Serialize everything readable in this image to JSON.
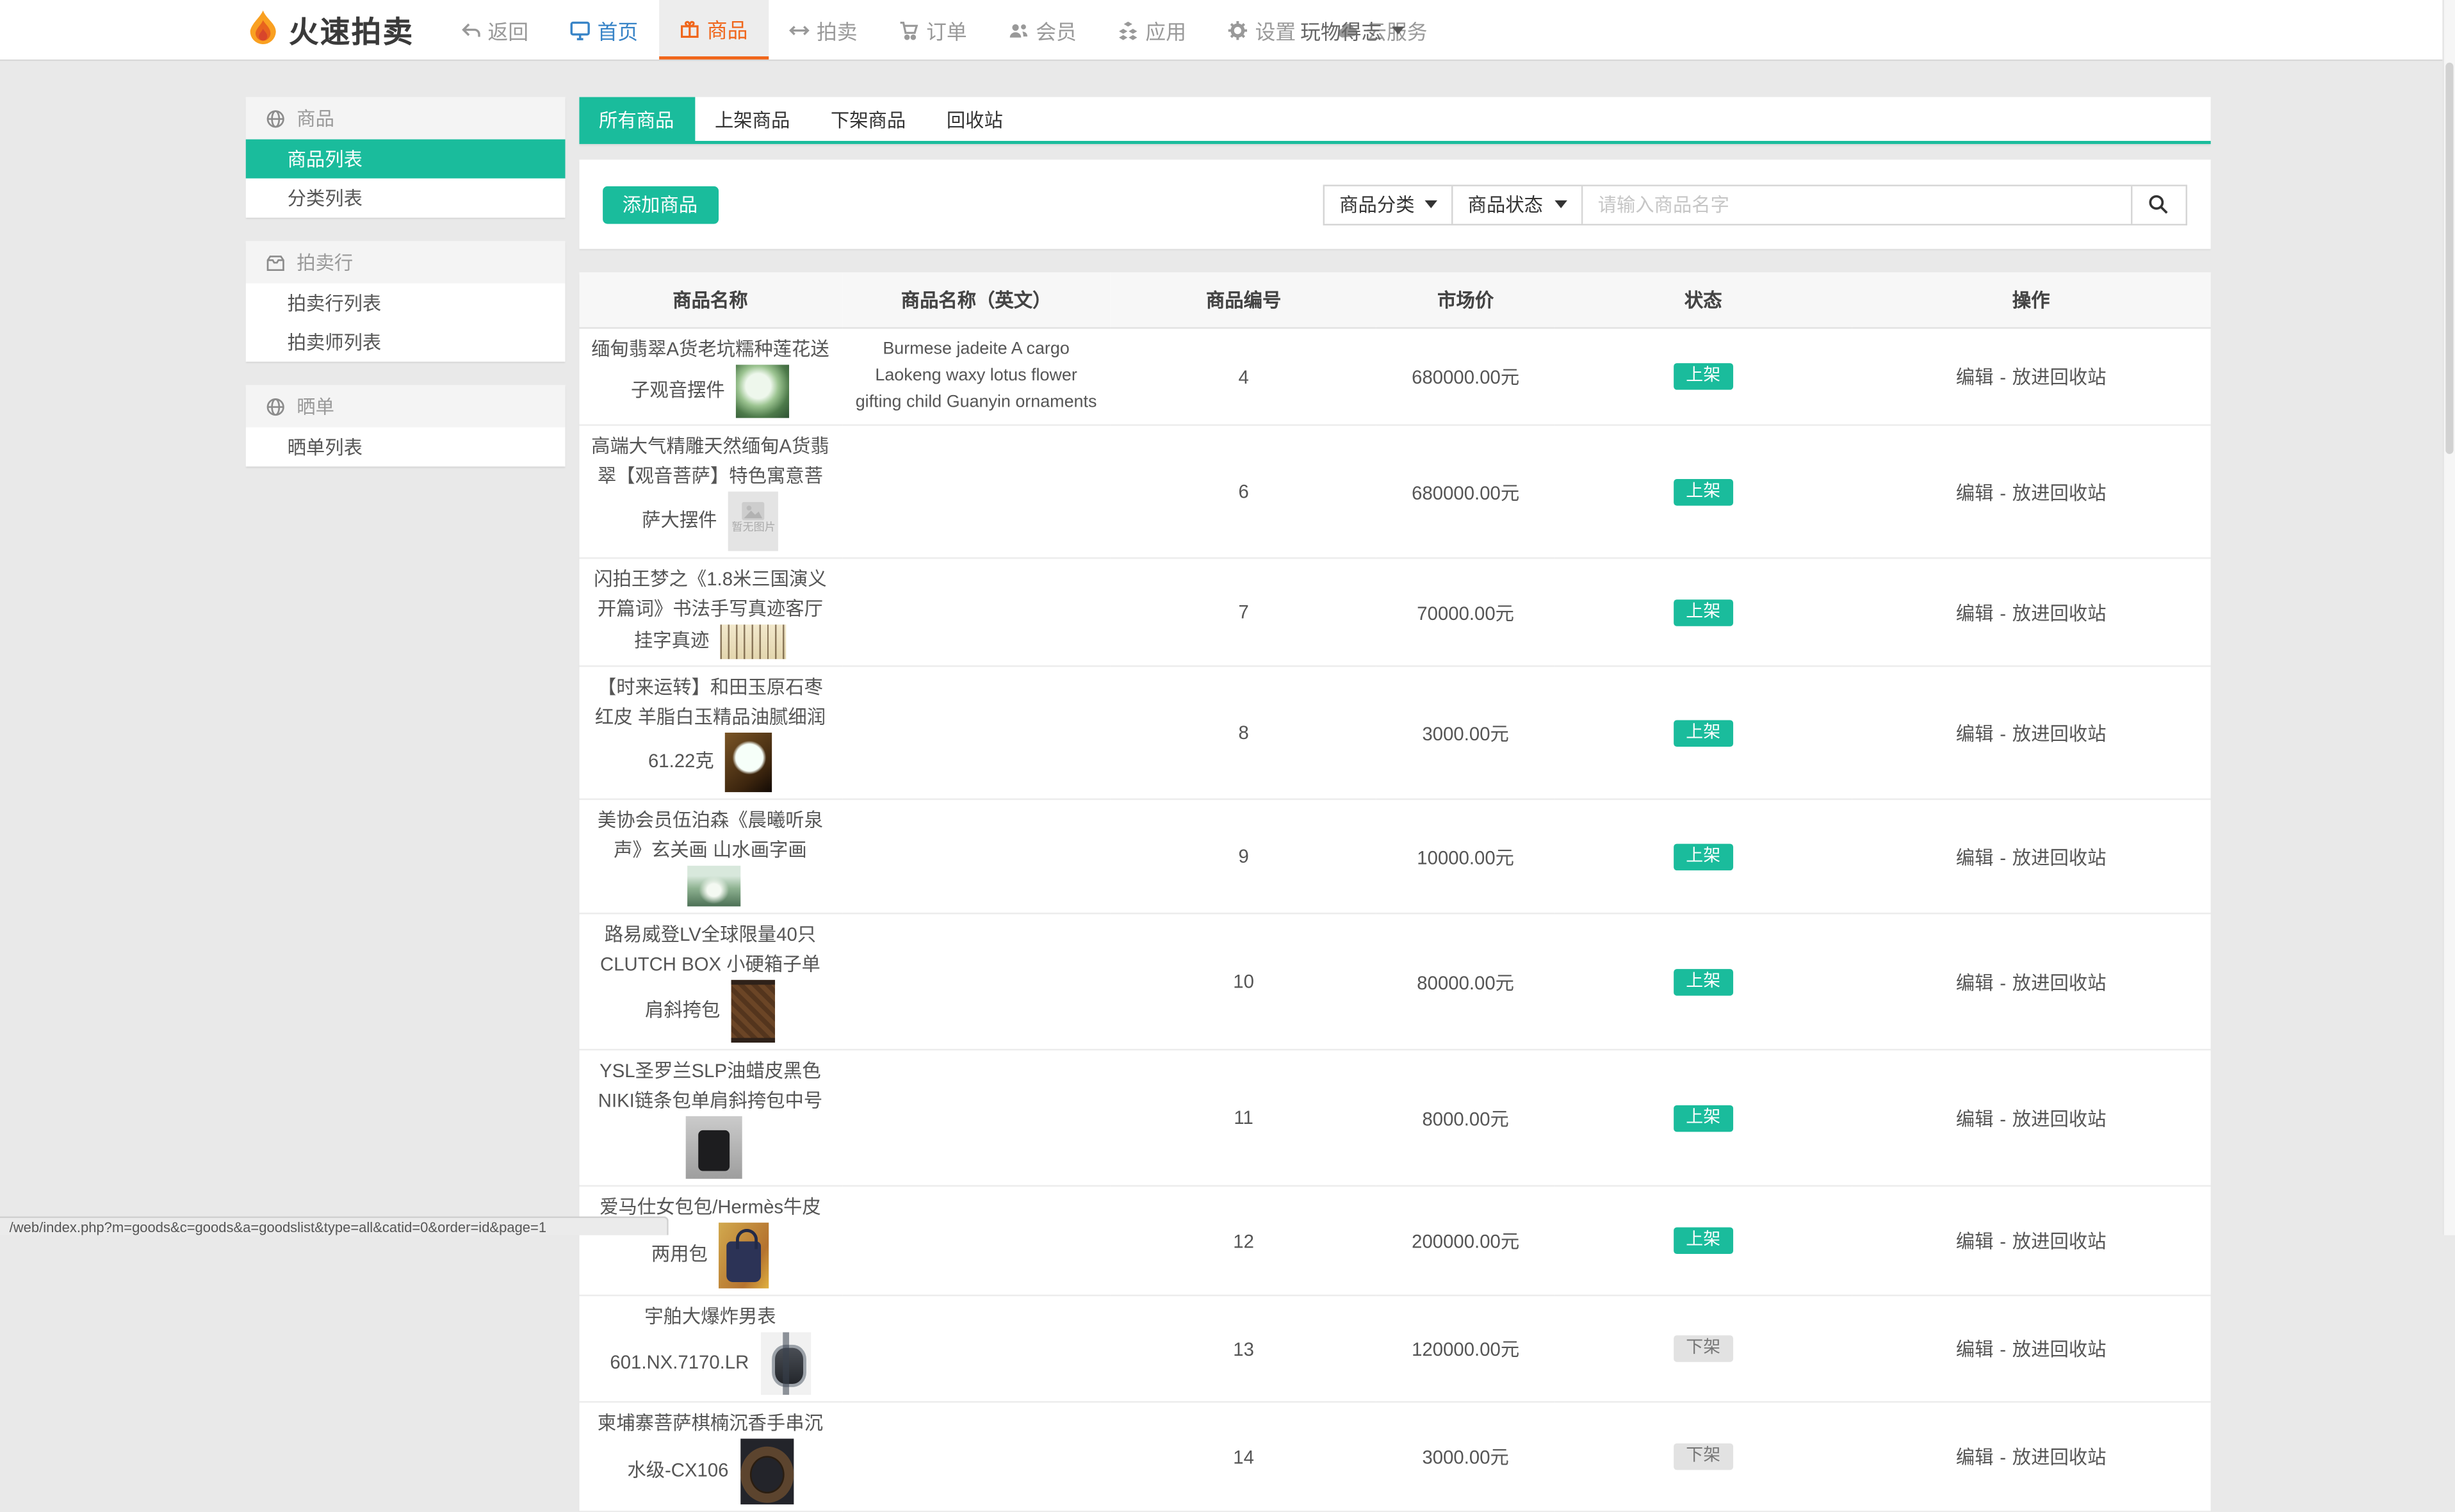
{
  "navbar": {
    "logo_text": "火速拍卖",
    "items": [
      {
        "label": "返回",
        "icon": "reply-icon",
        "active": false
      },
      {
        "label": "首页",
        "icon": "monitor-icon",
        "active": false
      },
      {
        "label": "商品",
        "icon": "gift-icon",
        "active": true
      },
      {
        "label": "拍卖",
        "icon": "left-right-arrows-icon",
        "active": false
      },
      {
        "label": "订单",
        "icon": "cart-icon",
        "active": false
      },
      {
        "label": "会员",
        "icon": "users-icon",
        "active": false
      },
      {
        "label": "应用",
        "icon": "cubes-icon",
        "active": false
      },
      {
        "label": "设置",
        "icon": "gear-icon",
        "active": false
      },
      {
        "label": "云服务",
        "icon": "cloud-icon",
        "active": false
      }
    ],
    "user_menu": "玩物得志"
  },
  "sidebar": {
    "groups": [
      {
        "title": "商品",
        "icon": "globe-icon",
        "items": [
          {
            "label": "商品列表",
            "active": true
          },
          {
            "label": "分类列表",
            "active": false
          }
        ]
      },
      {
        "title": "拍卖行",
        "icon": "archive-icon",
        "items": [
          {
            "label": "拍卖行列表",
            "active": false
          },
          {
            "label": "拍卖师列表",
            "active": false
          }
        ]
      },
      {
        "title": "晒单",
        "icon": "globe-icon",
        "items": [
          {
            "label": "晒单列表",
            "active": false
          }
        ]
      }
    ]
  },
  "tabs": [
    {
      "label": "所有商品",
      "active": true
    },
    {
      "label": "上架商品",
      "active": false
    },
    {
      "label": "下架商品",
      "active": false
    },
    {
      "label": "回收站",
      "active": false
    }
  ],
  "toolbar": {
    "add_button": "添加商品",
    "category_filter": "商品分类",
    "status_filter": "商品状态",
    "search_placeholder": "请输入商品名字"
  },
  "table": {
    "headers": [
      "商品名称",
      "商品名称（英文）",
      "商品编号",
      "市场价",
      "状态",
      "操作"
    ],
    "status_on": "上架",
    "status_off": "下架",
    "no_image_label": "暂无图片",
    "actions": {
      "edit": "编辑",
      "separator": "-",
      "recycle": "放进回收站"
    },
    "rows": [
      {
        "name": "缅甸翡翠A货老坑糯种莲花送子观音摆件",
        "name_en": "Burmese jadeite A cargo Laokeng waxy lotus flower gifting child Guanyin ornaments",
        "id": "4",
        "price": "680000.00元",
        "status": "上架",
        "thumb": "jade-guanyin"
      },
      {
        "name": "高端大气精雕天然缅甸A货翡翠【观音菩萨】特色寓意菩萨大摆件",
        "name_en": "",
        "id": "6",
        "price": "680000.00元",
        "status": "上架",
        "thumb": "no-image"
      },
      {
        "name": "闪拍王梦之《1.8米三国演义开篇词》书法手写真迹客厅挂字真迹",
        "name_en": "",
        "id": "7",
        "price": "70000.00元",
        "status": "上架",
        "thumb": "calligraphy"
      },
      {
        "name": "【时来运转】和田玉原石枣红皮 羊脂白玉精品油腻细润 61.22克",
        "name_en": "",
        "id": "8",
        "price": "3000.00元",
        "status": "上架",
        "thumb": "jade-raw"
      },
      {
        "name": "美协会员伍泊森《晨曦听泉声》玄关画 山水画字画",
        "name_en": "",
        "id": "9",
        "price": "10000.00元",
        "status": "上架",
        "thumb": "painting"
      },
      {
        "name": "路易威登LV全球限量40只CLUTCH BOX 小硬箱子单肩斜挎包",
        "name_en": "",
        "id": "10",
        "price": "80000.00元",
        "status": "上架",
        "thumb": "lv-bag"
      },
      {
        "name": "YSL圣罗兰SLP油蜡皮黑色NIKI链条包单肩斜挎包中号",
        "name_en": "",
        "id": "11",
        "price": "8000.00元",
        "status": "上架",
        "thumb": "ysl-bag"
      },
      {
        "name": "爱马仕女包包/Hermès牛皮两用包",
        "name_en": "",
        "id": "12",
        "price": "200000.00元",
        "status": "上架",
        "thumb": "hermes-bag"
      },
      {
        "name": "宇舶大爆炸男表 601.NX.7170.LR",
        "name_en": "",
        "id": "13",
        "price": "120000.00元",
        "status": "下架",
        "thumb": "watch"
      },
      {
        "name": "柬埔寨菩萨棋楠沉香手串沉水级-CX106",
        "name_en": "",
        "id": "14",
        "price": "3000.00元",
        "status": "下架",
        "thumb": "bracelet"
      }
    ]
  },
  "statusbar": {
    "text": "/web/index.php?m=goods&c=goods&a=goodslist&type=all&catid=0&order=id&page=1"
  },
  "colors": {
    "accent_teal": "#1abc9c",
    "accent_orange": "#f0661b",
    "link_blue": "#3884c7"
  }
}
